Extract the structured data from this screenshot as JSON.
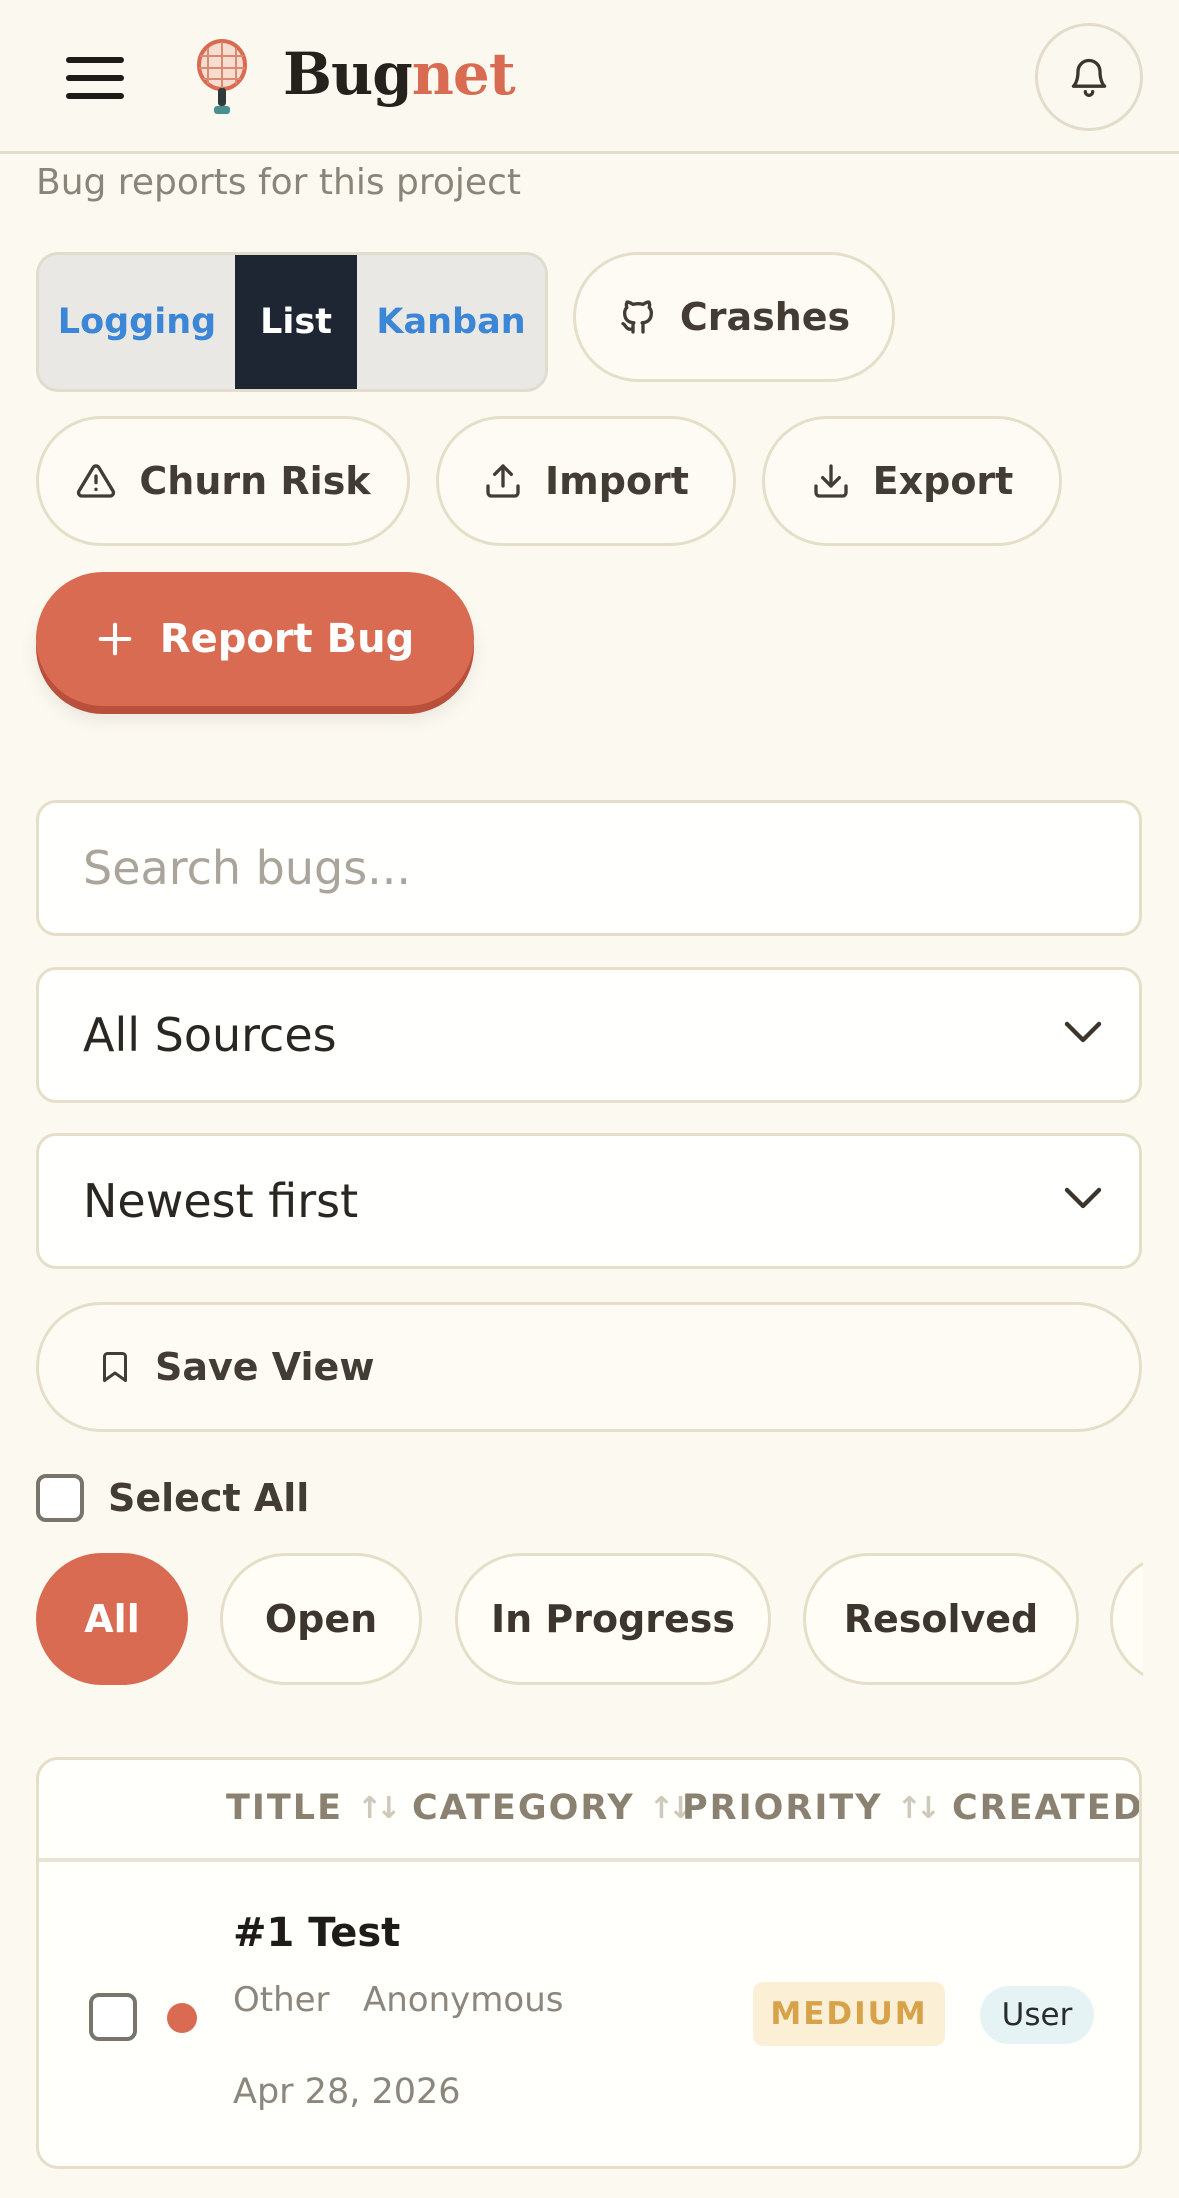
{
  "header": {
    "brand_part1": "Bug",
    "brand_part2": "net",
    "menu_icon": "hamburger-menu-icon",
    "logo_icon": "racket-logo-icon",
    "notification_icon": "bell-icon"
  },
  "subtitle": "Bug reports for this project",
  "view_tabs": {
    "items": [
      "Logging",
      "List",
      "Kanban"
    ],
    "active": "List"
  },
  "actions": {
    "crashes": "Crashes",
    "churn_risk": "Churn Risk",
    "import": "Import",
    "export": "Export",
    "report_bug": "Report Bug"
  },
  "search": {
    "placeholder": "Search bugs..."
  },
  "filters": {
    "source": "All Sources",
    "sort": "Newest first",
    "save_view": "Save View"
  },
  "select_all": "Select All",
  "status_chips": {
    "items": [
      "All",
      "Open",
      "In Progress",
      "Resolved"
    ],
    "active": "All"
  },
  "table": {
    "columns": [
      "TITLE",
      "CATEGORY",
      "PRIORITY",
      "CREATED"
    ],
    "rows": [
      {
        "title": "#1 Test",
        "category": "Other",
        "reporter": "Anonymous",
        "priority": "MEDIUM",
        "source": "User",
        "created": "Apr 28, 2026",
        "status_color": "#d96b52"
      }
    ]
  },
  "colors": {
    "accent": "#d96b52",
    "tab_active_bg": "#1e2634",
    "tab_link": "#3b86d6",
    "background": "#fcf9f0"
  }
}
